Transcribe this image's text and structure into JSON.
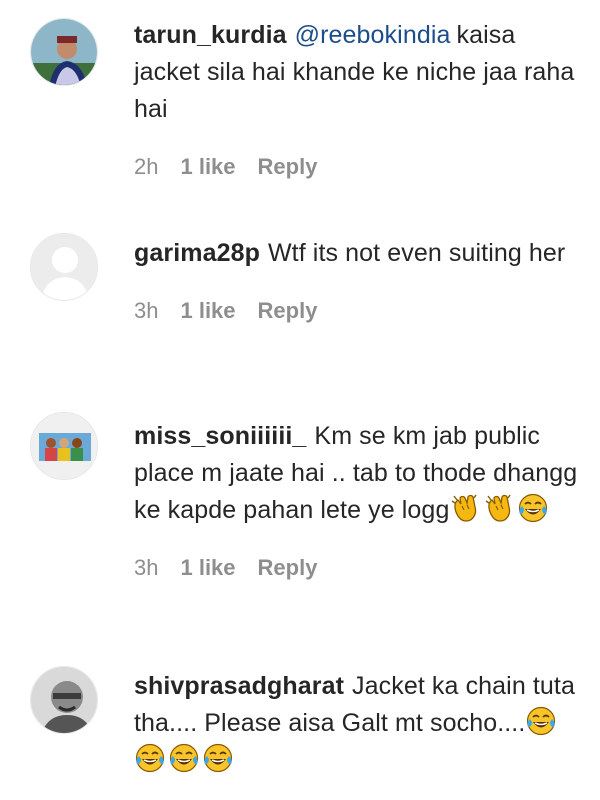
{
  "comments": [
    {
      "username": "tarun_kurdia",
      "mention": "@reebokindia",
      "text": "kaisa jacket sila hai khande ke niche jaa raha hai",
      "time": "2h",
      "likes": "1 like",
      "reply": "Reply"
    },
    {
      "username": "garima28p",
      "text": "Wtf its not even suiting her",
      "time": "3h",
      "likes": "1 like",
      "reply": "Reply"
    },
    {
      "username": "miss_soniiiiii_",
      "text": "Km se km jab public place m jaate hai .. tab to thode dhangg ke kapde pahan lete ye logg",
      "emojis": [
        "clapping-hands-emoji",
        "clapping-hands-emoji",
        "face-with-tears-of-joy-emoji"
      ],
      "time": "3h",
      "likes": "1 like",
      "reply": "Reply"
    },
    {
      "username": "shivprasadgharat",
      "text": "Jacket ka chain tuta tha.... Please aisa Galt mt socho....",
      "emojis": [
        "face-with-tears-of-joy-emoji",
        "face-with-tears-of-joy-emoji",
        "face-with-tears-of-joy-emoji",
        "face-with-tears-of-joy-emoji"
      ]
    }
  ],
  "colors": {
    "text": "#262626",
    "mention": "#1d4e89",
    "meta": "#8e8e8e",
    "background": "#ffffff"
  }
}
